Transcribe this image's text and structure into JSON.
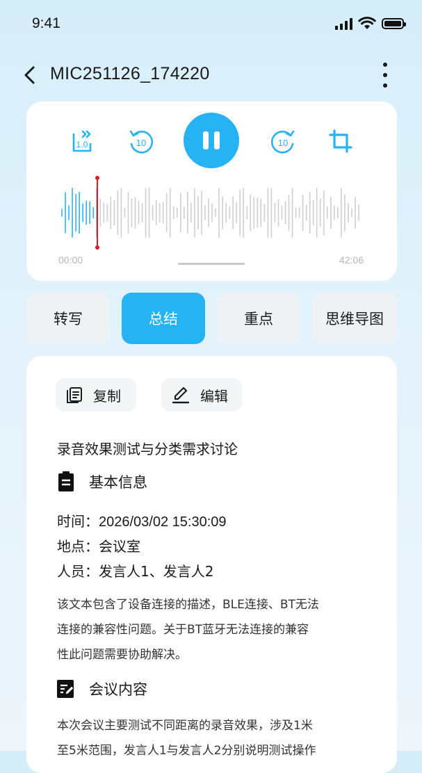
{
  "status_bar": {
    "time": "9:41"
  },
  "header": {
    "title": "MIC251126_174220"
  },
  "player": {
    "speed_label": "1.0",
    "rewind_label": "10",
    "forward_label": "10",
    "time_start": "00:00",
    "time_end": "42:06",
    "progress_fraction": 0.12,
    "accent": "#27b3f3",
    "playhead_color": "#e21b1b"
  },
  "tabs": [
    {
      "label": "转写"
    },
    {
      "label": "总结"
    },
    {
      "label": "重点"
    },
    {
      "label": "思维导图"
    }
  ],
  "toolbar": {
    "copy_label": "复制",
    "edit_label": "编辑"
  },
  "summary": {
    "title": "录音效果测试与分类需求讨论",
    "basic_heading": "基本信息",
    "time_label": "时间：",
    "time_value": "2026/03/02  15:30:09",
    "place_label": "地点：",
    "place_value": "会议室",
    "people_label": "人员：",
    "people_value": "发言人1、发言人2",
    "description_lines": [
      "该文本包含了设备连接的描述，BLE连接、BT无法",
      "连接的兼容性问题。关于BT蓝牙无法连接的兼容",
      "性此问题需要协助解决。"
    ],
    "meeting_heading": "会议内容",
    "meeting_lines": [
      "本次会议主要测试不同距离的录音效果，涉及1米",
      "至5米范围，发言人1与发言人2分别说明测试操作"
    ]
  }
}
